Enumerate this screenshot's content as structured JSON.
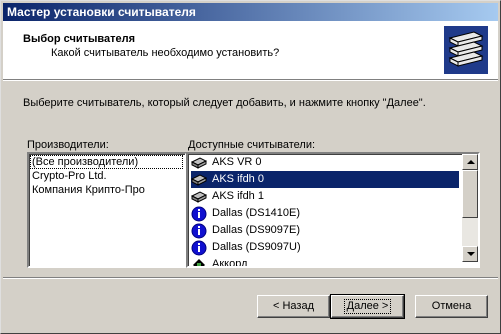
{
  "window": {
    "title": "Мастер установки считывателя"
  },
  "header": {
    "title": "Выбор считывателя",
    "subtitle": "Какой считыватель необходимо установить?"
  },
  "instruction": "Выберите считыватель, который следует добавить, и нажмите кнопку \"Далее\".",
  "vendors": {
    "label": "Производители:",
    "items": [
      "(Все производители)",
      "Crypto-Pro Ltd.",
      "Компания Крипто-Про"
    ],
    "selected": "(Все производители)"
  },
  "readers": {
    "label": "Доступные считыватели:",
    "items": [
      {
        "label": "AKS VR 0",
        "icon": "card-reader-icon"
      },
      {
        "label": "AKS ifdh 0",
        "icon": "card-reader-icon"
      },
      {
        "label": "AKS ifdh 1",
        "icon": "card-reader-icon"
      },
      {
        "label": "Dallas (DS1410E)",
        "icon": "info-icon"
      },
      {
        "label": "Dallas (DS9097E)",
        "icon": "info-icon"
      },
      {
        "label": "Dallas (DS9097U)",
        "icon": "info-icon"
      },
      {
        "label": "Аккорд",
        "icon": "reader-icon"
      }
    ],
    "selected": "AKS ifdh 0"
  },
  "buttons": {
    "back": "< Назад",
    "next": "Далее >",
    "cancel": "Отмена"
  },
  "colors": {
    "title_bar_start": "#0a246a",
    "title_bar_end": "#a6caf0",
    "selection": "#0a246a",
    "face": "#d4d0c8"
  }
}
